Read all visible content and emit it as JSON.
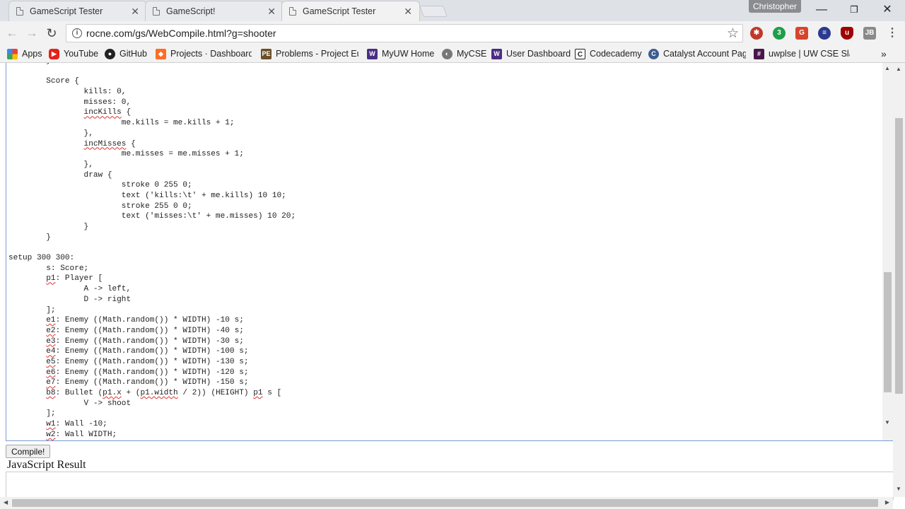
{
  "tabs": [
    {
      "title": "GameScript Tester",
      "active": false
    },
    {
      "title": "GameScript!",
      "active": false
    },
    {
      "title": "GameScript Tester",
      "active": true
    }
  ],
  "profile_name": "Christopher",
  "window_controls": {
    "minimize": "—",
    "restore": "❐",
    "close": "✕"
  },
  "address_bar": {
    "url": "rocne.com/gs/WebCompile.html?g=shooter"
  },
  "bookmarks": [
    {
      "label": "Apps",
      "icon": "apps-grid-icon"
    },
    {
      "label": "YouTube",
      "icon": "youtube-icon"
    },
    {
      "label": "GitHub",
      "icon": "github-icon"
    },
    {
      "label": "Projects · Dashboard ·",
      "icon": "gitlab-icon"
    },
    {
      "label": "Problems - Project Eu",
      "icon": "project-euler-icon"
    },
    {
      "label": "MyUW Home",
      "icon": "myuw-icon"
    },
    {
      "label": "MyCSE",
      "icon": "mycse-icon"
    },
    {
      "label": "User Dashboard",
      "icon": "uw-icon"
    },
    {
      "label": "Codecademy",
      "icon": "codecademy-icon"
    },
    {
      "label": "Catalyst Account Page",
      "icon": "catalyst-icon"
    },
    {
      "label": "uwplse | UW CSE Slac",
      "icon": "slack-icon"
    }
  ],
  "editor_code": [
    "\t}",
    "",
    "\tScore {",
    "\t\tkills: 0,",
    "\t\tmisses: 0,",
    "\t\tincKills {",
    "\t\t\tme.kills = me.kills + 1;",
    "\t\t},",
    "\t\tincMisses {",
    "\t\t\tme.misses = me.misses + 1;",
    "\t\t},",
    "\t\tdraw {",
    "\t\t\tstroke 0 255 0;",
    "\t\t\ttext ('kills:\\t' + me.kills) 10 10;",
    "\t\t\tstroke 255 0 0;",
    "\t\t\ttext ('misses:\\t' + me.misses) 10 20;",
    "\t\t}",
    "\t}",
    "",
    "setup 300 300:",
    "\ts: Score;",
    "\tp1: Player [",
    "\t\tA -> left,",
    "\t\tD -> right",
    "\t];",
    "\te1: Enemy ((Math.random()) * WIDTH) -10 s;",
    "\te2: Enemy ((Math.random()) * WIDTH) -40 s;",
    "\te3: Enemy ((Math.random()) * WIDTH) -30 s;",
    "\te4: Enemy ((Math.random()) * WIDTH) -100 s;",
    "\te5: Enemy ((Math.random()) * WIDTH) -130 s;",
    "\te6: Enemy ((Math.random()) * WIDTH) -120 s;",
    "\te7: Enemy ((Math.random()) * WIDTH) -150 s;",
    "\tb8: Bullet (p1.x + (p1.width / 2)) (HEIGHT) p1 s [",
    "\t\tV -> shoot",
    "\t];",
    "\tw1: Wall -10;",
    "\tw2: Wall WIDTH;"
  ],
  "spellcheck_words": [
    "incKills",
    "incMisses",
    "p1",
    "e1",
    "e2",
    "e3",
    "e4",
    "e5",
    "e6",
    "e7",
    "b8",
    "p1.x",
    "p1.width",
    "w1",
    "w2"
  ],
  "compile_button": "Compile!",
  "result_heading": "JavaScript Result"
}
